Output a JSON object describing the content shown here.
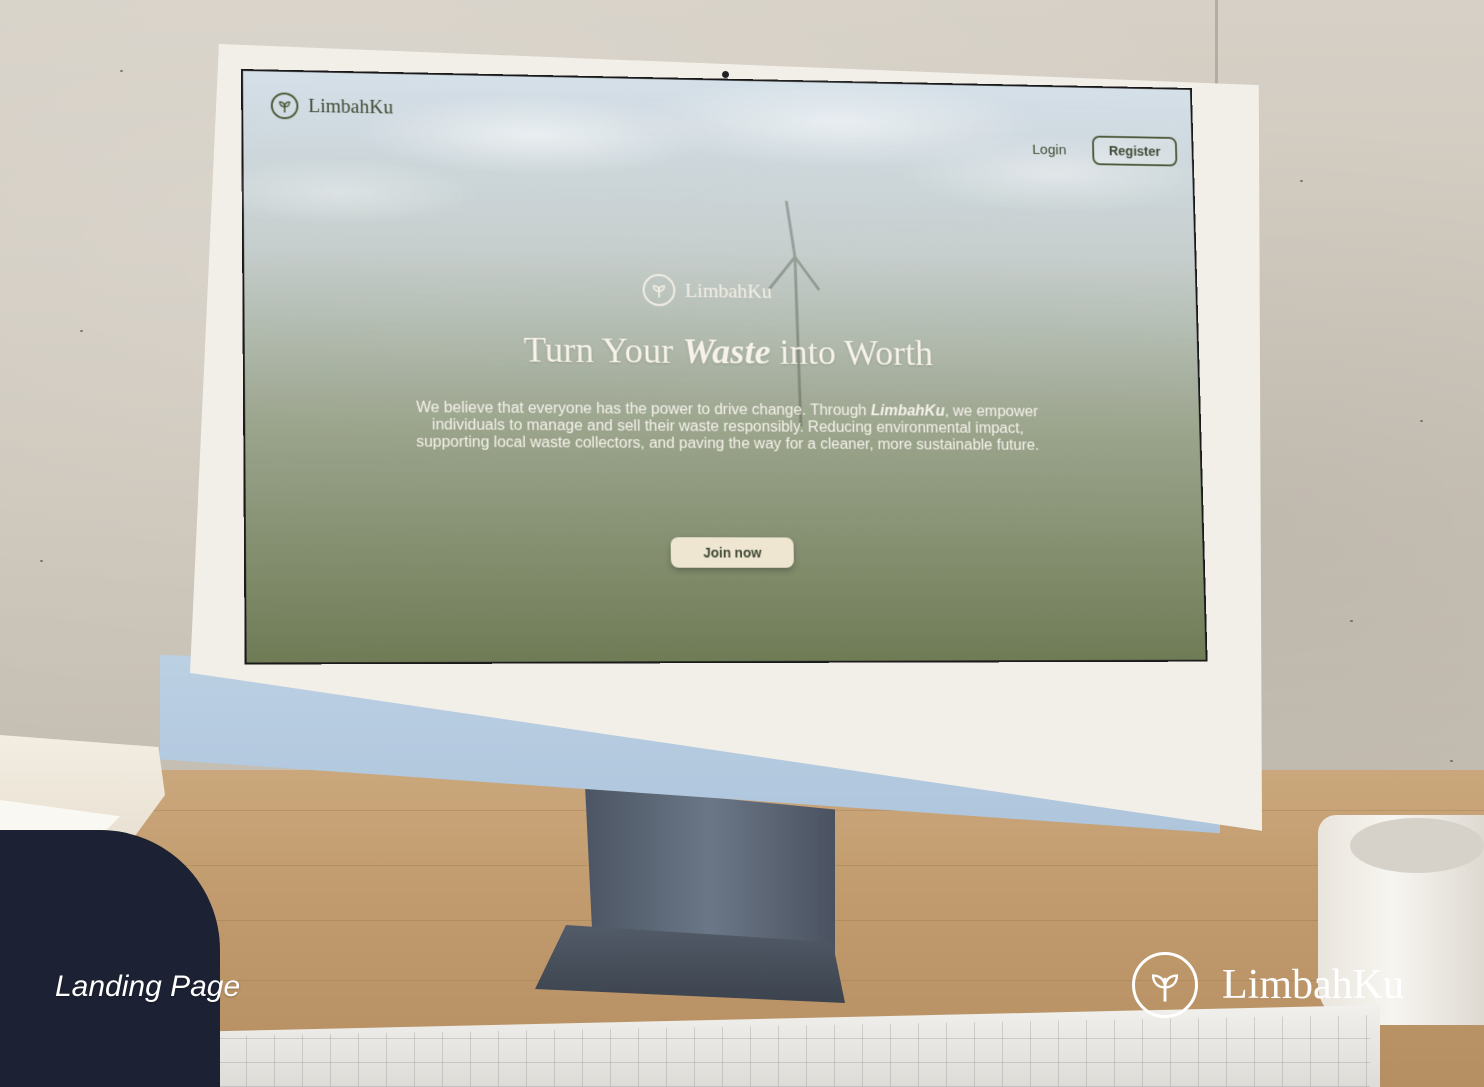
{
  "website": {
    "nav": {
      "brand": "LimbahKu",
      "login_label": "Login",
      "register_label": "Register"
    },
    "hero": {
      "brand": "LimbahKu",
      "title_part1": "Turn Your ",
      "title_emphasis": "Waste",
      "title_part2": " into Worth",
      "body_part1": "We believe that everyone has the power to drive change. Through ",
      "body_brand": "LimbahKu",
      "body_part2": ", we empower individuals to manage and sell their waste responsibly. Reducing environmental impact, supporting local waste collectors, and paving the way for a cleaner, more sustainable future.",
      "cta_label": "Join now"
    }
  },
  "presentation": {
    "caption": "Landing Page",
    "brand": "LimbahKu"
  },
  "colors": {
    "brand_green": "#4d5a3a",
    "cream": "#efe6d2",
    "monitor_blue": "#aec5dc"
  },
  "icons": {
    "logo": "leaf-sprout-icon"
  }
}
